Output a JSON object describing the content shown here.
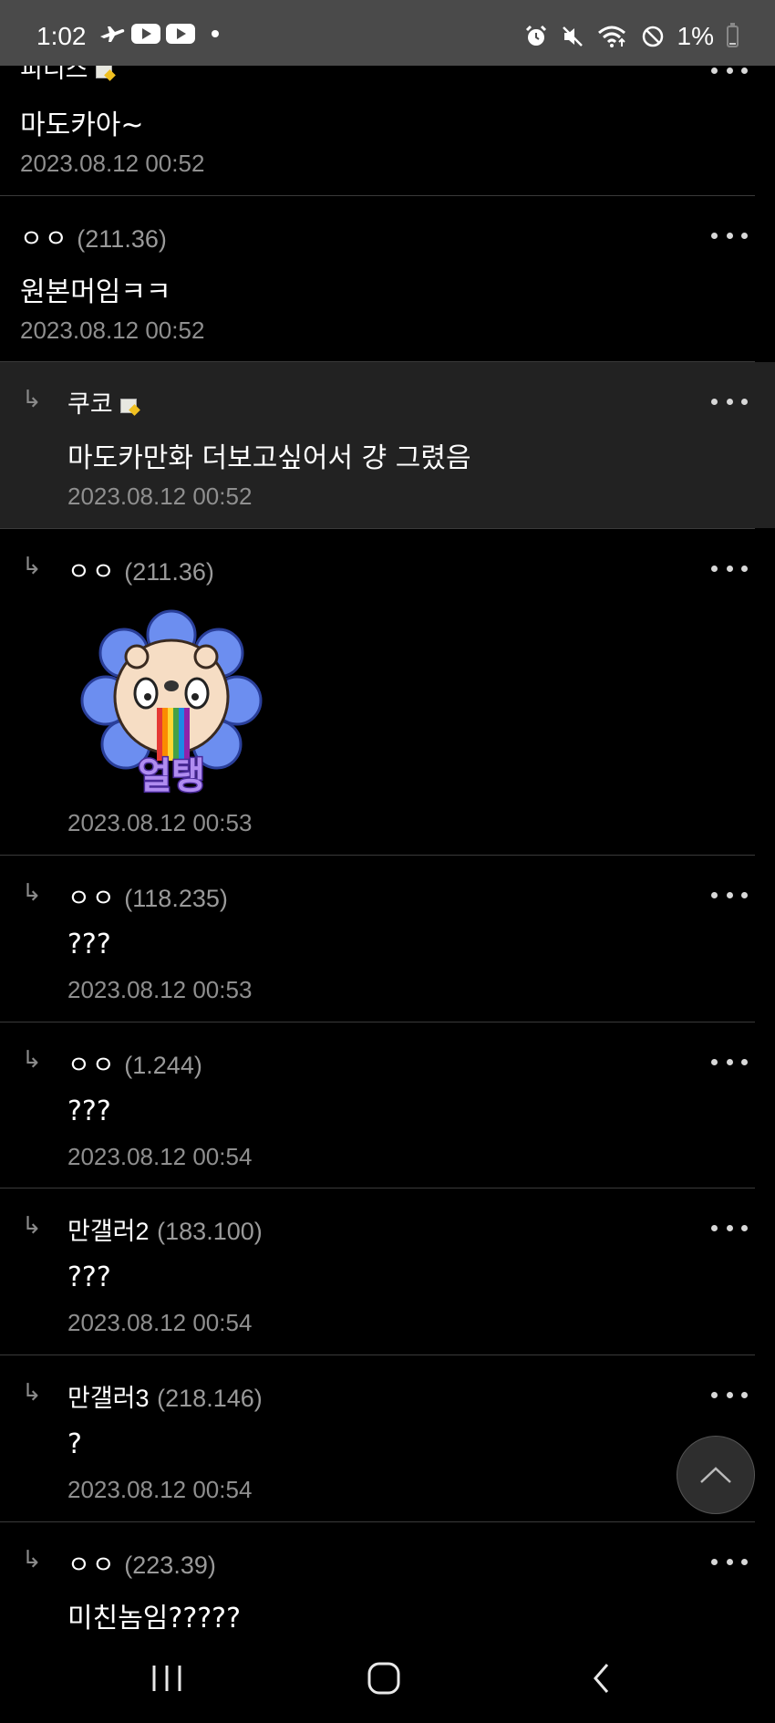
{
  "status_bar": {
    "time": "1:02",
    "battery": "1%",
    "icons": [
      "flight-icon",
      "youtube-icon",
      "youtube-icon",
      "alarm-icon",
      "mute-icon",
      "wifi-icon",
      "do-not-disturb-icon",
      "battery-icon"
    ]
  },
  "comments": [
    {
      "author": "피디스",
      "ip": "",
      "has_memo_icon": true,
      "text": "마도카아~",
      "time": "2023.08.12 00:52",
      "reply": false
    },
    {
      "author": "ㅇㅇ",
      "ip": "(211.36)",
      "text": "원본머임ㅋㅋ",
      "time": "2023.08.12 00:52",
      "reply": false
    },
    {
      "author": "쿠코",
      "ip": "",
      "has_memo_icon": true,
      "text": "마도카만화 더보고싶어서 걍 그렸음",
      "time": "2023.08.12 00:52",
      "reply": true,
      "highlighted": true
    },
    {
      "author": "ㅇㅇ",
      "ip": "(211.36)",
      "text": "",
      "sticker": "bear-flower-rainbow-sticker",
      "sticker_text": "얼탱",
      "time": "2023.08.12 00:53",
      "reply": true
    },
    {
      "author": "ㅇㅇ",
      "ip": "(118.235)",
      "text": "???",
      "time": "2023.08.12 00:53",
      "reply": true
    },
    {
      "author": "ㅇㅇ",
      "ip": "(1.244)",
      "text": "???",
      "time": "2023.08.12 00:54",
      "reply": true
    },
    {
      "author": "만갤러",
      "author_num": "2",
      "ip": "(183.100)",
      "text": "???",
      "time": "2023.08.12 00:54",
      "reply": true
    },
    {
      "author": "만갤러",
      "author_num": "3",
      "ip": "(218.146)",
      "text": "?",
      "time": "2023.08.12 00:54",
      "reply": true
    },
    {
      "author": "ㅇㅇ",
      "ip": "(223.39)",
      "text": "미친놈임?????",
      "time": "",
      "reply": true
    }
  ],
  "reply_marker": "↳",
  "nav_bar": {
    "buttons": [
      "recent-apps",
      "home",
      "back"
    ]
  },
  "colors": {
    "background": "#000000",
    "highlight_row": "#222222",
    "status_bar": "#4a4a4a",
    "muted_text": "#8f8f8f"
  }
}
